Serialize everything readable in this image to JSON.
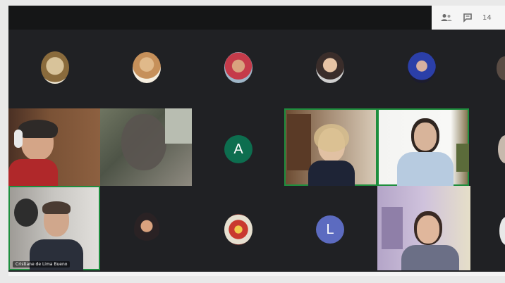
{
  "toolbar": {
    "people_count": "14",
    "icons": [
      "people-icon",
      "chat-icon"
    ]
  },
  "tiles": {
    "letter_a": "A",
    "letter_l": "L",
    "name_tag": "Cristiane de Lima Bueno"
  },
  "colors": {
    "background": "#202124",
    "speaking_border": "#1e8e3e",
    "avatar_a": "#0d6e4f",
    "avatar_l": "#5c6bc0"
  }
}
